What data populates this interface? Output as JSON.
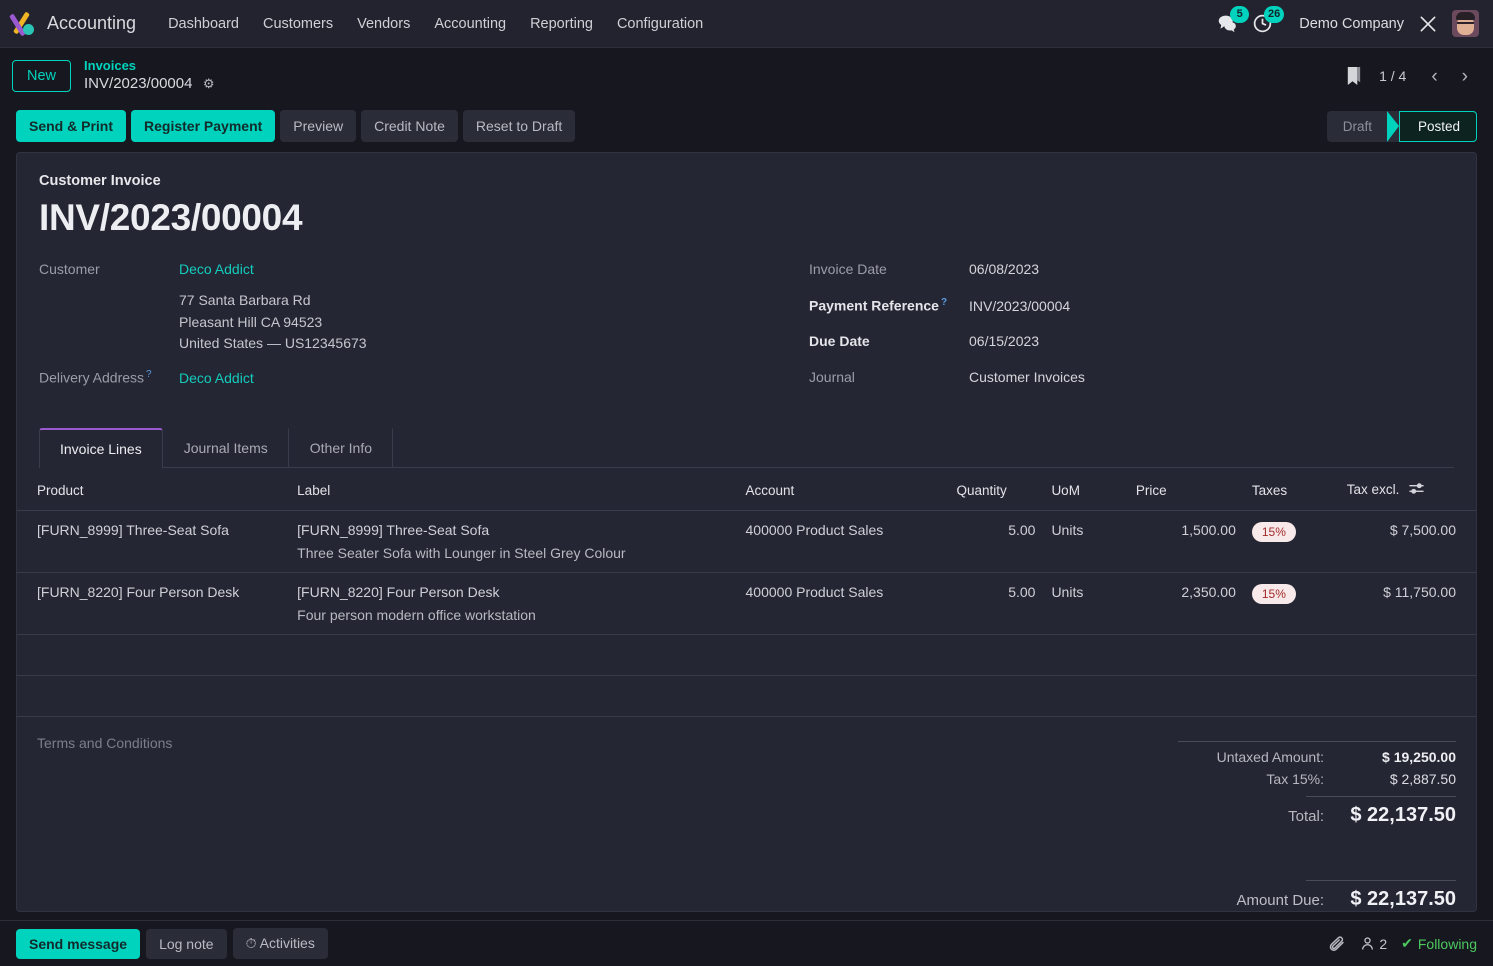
{
  "navbar": {
    "brand": "Accounting",
    "menu": [
      "Dashboard",
      "Customers",
      "Vendors",
      "Accounting",
      "Reporting",
      "Configuration"
    ],
    "messages_badge": "5",
    "activities_badge": "26",
    "company": "Demo Company",
    "icons": {
      "messages": "chat-bubble-icon",
      "activities": "clock-icon",
      "tools": "wrench-icon",
      "avatar": "user-avatar"
    }
  },
  "control_panel": {
    "new_label": "New",
    "breadcrumb_parent": "Invoices",
    "breadcrumb_current": "INV/2023/00004",
    "gear": "gear-icon",
    "pager": "1 / 4",
    "prev": "‹",
    "next": "›"
  },
  "actions": {
    "primary": [
      "Send & Print",
      "Register Payment"
    ],
    "secondary": [
      "Preview",
      "Credit Note",
      "Reset to Draft"
    ],
    "status": [
      "Draft",
      "Posted"
    ],
    "status_active": "Posted"
  },
  "document": {
    "type": "Customer Invoice",
    "title": "INV/2023/00004",
    "customer_label": "Customer",
    "customer_name": "Deco Addict",
    "address": [
      "77 Santa Barbara Rd",
      "Pleasant Hill CA 94523",
      "United States — US12345673"
    ],
    "delivery_label": "Delivery Address",
    "delivery_value": "Deco Addict",
    "invoice_date_label": "Invoice Date",
    "invoice_date": "06/08/2023",
    "payment_ref_label": "Payment Reference",
    "payment_ref": "INV/2023/00004",
    "due_date_label": "Due Date",
    "due_date": "06/15/2023",
    "journal_label": "Journal",
    "journal": "Customer Invoices"
  },
  "tabs": [
    {
      "label": "Invoice Lines",
      "active": true
    },
    {
      "label": "Journal Items",
      "active": false
    },
    {
      "label": "Other Info",
      "active": false
    }
  ],
  "lines_table": {
    "headers": {
      "product": "Product",
      "label": "Label",
      "account": "Account",
      "quantity": "Quantity",
      "uom": "UoM",
      "price": "Price",
      "taxes": "Taxes",
      "tax_excl": "Tax excl."
    },
    "rows": [
      {
        "product": "[FURN_8999] Three-Seat Sofa",
        "label": "[FURN_8999] Three-Seat Sofa",
        "description": "Three Seater Sofa with Lounger in Steel Grey Colour",
        "account": "400000 Product Sales",
        "quantity": "5.00",
        "uom": "Units",
        "price": "1,500.00",
        "tax": "15%",
        "tax_excl": "$ 7,500.00"
      },
      {
        "product": "[FURN_8220] Four Person Desk",
        "label": "[FURN_8220] Four Person Desk",
        "description": "Four person modern office workstation",
        "account": "400000 Product Sales",
        "quantity": "5.00",
        "uom": "Units",
        "price": "2,350.00",
        "tax": "15%",
        "tax_excl": "$ 11,750.00"
      }
    ]
  },
  "terms_placeholder": "Terms and Conditions",
  "totals": {
    "untaxed_label": "Untaxed Amount:",
    "untaxed_value": "$ 19,250.00",
    "tax_label": "Tax 15%:",
    "tax_value": "$ 2,887.50",
    "total_label": "Total:",
    "total_value": "$ 22,137.50",
    "due_label": "Amount Due:",
    "due_value": "$ 22,137.50"
  },
  "chatter": {
    "send_message": "Send message",
    "log_note": "Log note",
    "activities": "Activities",
    "follower_count": "2",
    "following": "Following"
  },
  "colors": {
    "accent": "#00d3bd",
    "tab_indicator": "#9b59d0",
    "tax_badge_bg": "#f8eaea",
    "tax_badge_text": "#a32929",
    "following_green": "#4cc85f",
    "page_bg": "#17181f",
    "sheet_bg": "#242633"
  }
}
